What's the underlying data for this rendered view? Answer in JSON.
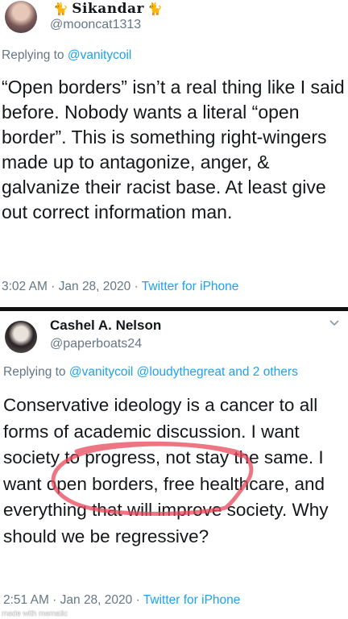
{
  "tweets": [
    {
      "display_name": "Sikandar",
      "name_emoji": "🐈",
      "handle": "@mooncat1313",
      "reply_prefix": "Replying to",
      "reply_to": "@vanitycoil",
      "reply_extra": "",
      "body": "“Open borders” isn’t a real thing like I said before. Nobody wants a literal “open border”. This is something right-wingers made up to antagonize, anger, & galvanize their racist base. At least give out correct information man.",
      "time": "3:02 AM · Jan 28, 2020 ·",
      "source": "Twitter for iPhone"
    },
    {
      "display_name": "Cashel A. Nelson",
      "handle": "@paperboats24",
      "reply_prefix": "Replying to",
      "reply_to": "@vanitycoil @loudythegreat",
      "reply_extra": "and 2 others",
      "body": "Conservative ideology is a cancer to all forms of academic discussion. I want society to progress, not stay the same. I want open borders, free healthcare, and everything that will improve society. Why should we be regressive?",
      "time": "2:51 AM · Jan 28, 2020 ·",
      "source": "Twitter for iPhone"
    }
  ],
  "watermark": "made with mematic",
  "colors": {
    "link": "#1da1f2",
    "muted": "#657786",
    "text": "#14171a",
    "scribble": "#e8475a"
  }
}
